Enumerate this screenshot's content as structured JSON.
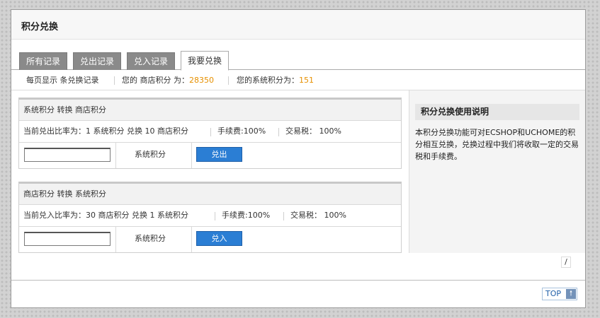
{
  "header": {
    "title": "积分兑换"
  },
  "tabs": [
    {
      "label": "所有记录"
    },
    {
      "label": "兑出记录"
    },
    {
      "label": "兑入记录"
    },
    {
      "label": "我要兑换"
    }
  ],
  "stats": {
    "per_page": "每页显示 条兑换记录",
    "shop_prefix": "您的 商店积分 为：",
    "shop_value": "28350",
    "system_prefix": "您的系统积分为：",
    "system_value": "151"
  },
  "exchange_out": {
    "title": "系统积分 转换 商店积分",
    "rate": "当前兑出比率为：1 系统积分 兑换 10 商店积分",
    "fee": "手续费:100%",
    "tax": "交易税： 100%",
    "input_value": "",
    "unit_label": "系统积分",
    "button_label": "兑出"
  },
  "exchange_in": {
    "title": "商店积分 转换 系统积分",
    "rate": "当前兑入比率为：30 商店积分 兑换 1 系统积分",
    "fee": "手续费:100%",
    "tax": "交易税： 100%",
    "input_value": "",
    "unit_label": "系统积分",
    "button_label": "兑入"
  },
  "help": {
    "title": "积分兑换使用说明",
    "text": "本积分兑换功能可对ECSHOP和UCHOME的积分相互兑换，兑换过程中我们将收取一定的交易税和手续费。"
  },
  "pager": {
    "text": "/"
  },
  "footer": {
    "top_label": "TOP",
    "top_icon": "arrow-up-icon"
  }
}
